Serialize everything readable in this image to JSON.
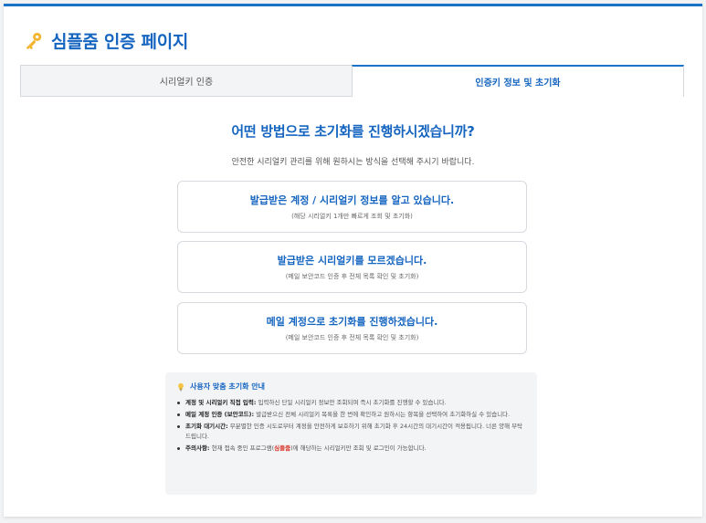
{
  "page": {
    "title": "심플줌 인증 페이지",
    "icon": "key-icon"
  },
  "tabs": [
    {
      "label": "시리얼키 인증",
      "active": false
    },
    {
      "label": "인증키 정보 및 초기화",
      "active": true
    }
  ],
  "main": {
    "question": "어떤 방법으로 초기화를 진행하시겠습니까?",
    "subtitle": "안전한 시리얼키 관리를 위해 원하시는 방식을 선택해 주시기 바랍니다."
  },
  "options": [
    {
      "title": "발급받은 계정 / 시리얼키 정보를 알고 있습니다.",
      "desc": "(해당 시리얼키 1개만 빠르게 조회 및 초기화)"
    },
    {
      "title": "발급받은 시리얼키를 모르겠습니다.",
      "desc": "(메일 보안코드 인증 후 전체 목록 확인 및 초기화)"
    },
    {
      "title": "메일 계정으로 초기화를 진행하겠습니다.",
      "desc": "(메일 보안코드 인증 후 전체 목록 확인 및 초기화)"
    }
  ],
  "guide": {
    "title": "사용자 맞춤 초기화 안내",
    "icon": "lightbulb-icon",
    "items": [
      {
        "label": "계정 및 시리얼키 직접 입력:",
        "text": " 입력하신 단일 시리얼키 정보만 조회되며 즉시 초기화를 진행할 수 있습니다."
      },
      {
        "label": "메일 계정 인증 (보안코드):",
        "text": " 발급받으신 전체 시리얼키 목록을 한 번에 확인하고 원하시는 항목을 선택하여 초기화하실 수 있습니다."
      },
      {
        "label": "초기화 대기시간:",
        "text": " 무분별한 인증 시도로부터 계정을 안전하게 보호하기 위해 초기화 후 24시간의 대기시간이 적용됩니다. 너른 양해 부탁드립니다."
      },
      {
        "label": "주의사항:",
        "text_before": " 현재 접속 중인 프로그램(",
        "highlight": "심플줌",
        "text_after": ")에 해당하는 시리얼키만 조회 및 로그인이 가능합니다."
      }
    ]
  },
  "colors": {
    "accent": "#1565c0",
    "top_border": "#1a73c9",
    "highlight": "#d93025"
  }
}
